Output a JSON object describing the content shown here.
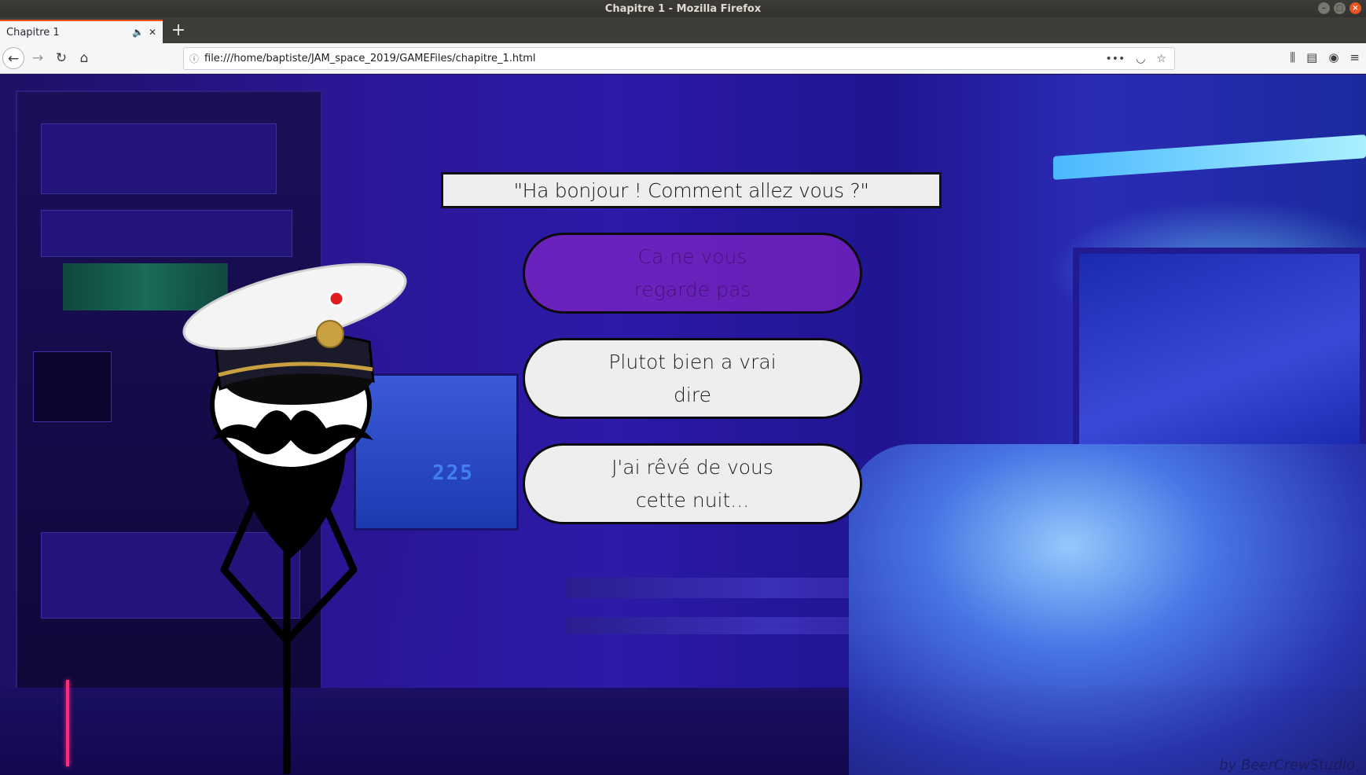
{
  "window": {
    "title": "Chapitre 1 - Mozilla Firefox",
    "controls": [
      "minimize",
      "maximize",
      "close"
    ]
  },
  "tabs": [
    {
      "label": "Chapitre 1",
      "icons": [
        "speaker-icon",
        "close-icon"
      ]
    }
  ],
  "newtab_label": "+",
  "navbar": {
    "url": "file:///home/baptiste/JAM_space_2019/GAMEFiles/chapitre_1.html",
    "url_actions": [
      "more-icon",
      "pocket-icon",
      "bookmark-star-icon"
    ],
    "right_tools": [
      "library-icon",
      "sidebar-icon",
      "account-icon",
      "menu-icon"
    ]
  },
  "game": {
    "dialogue": "\"Ha bonjour ! Comment allez vous ?\"",
    "choices": [
      {
        "line1": "Ca ne vous",
        "line2": "regarde pas",
        "state": "hovered"
      },
      {
        "line1": "Plutot bien a vrai",
        "line2": "dire",
        "state": "normal"
      },
      {
        "line1": "J'ai rêvé de vous",
        "line2": "cette nuit...",
        "state": "normal"
      }
    ],
    "scenery_text": "225",
    "credit": "by BeerCrewStudio",
    "colors": {
      "background": "#2c1aa8",
      "choice_bg": "#efeeee",
      "choice_hover_bg": "#a028d2",
      "border": "#0b0b0b",
      "tab_accent": "#e95420"
    }
  }
}
